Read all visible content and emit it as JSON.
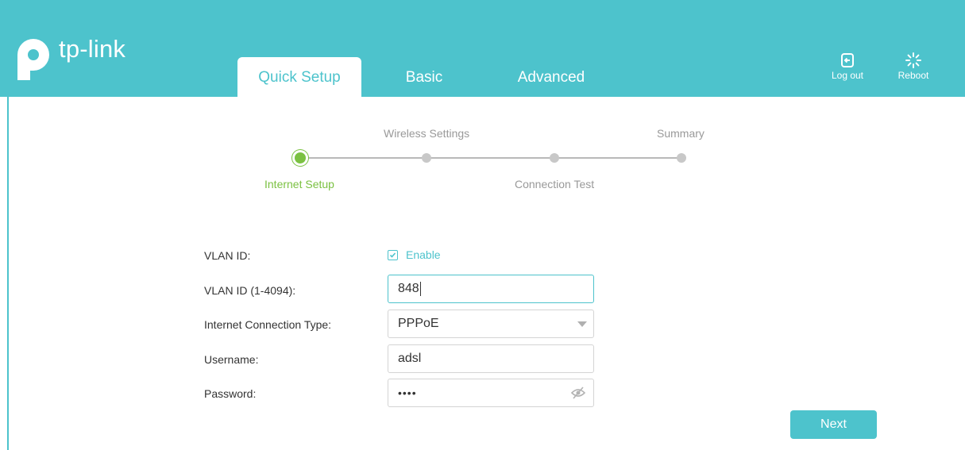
{
  "header": {
    "logo_text": "tp-link",
    "tabs": [
      {
        "label": "Quick Setup",
        "active": true
      },
      {
        "label": "Basic",
        "active": false
      },
      {
        "label": "Advanced",
        "active": false
      }
    ],
    "logout_label": "Log out",
    "reboot_label": "Reboot",
    "icons": {
      "logout": "logout-icon",
      "reboot": "reboot-icon"
    }
  },
  "stepper": {
    "steps": [
      {
        "label": "Internet Setup",
        "active": true
      },
      {
        "label": "Wireless Settings",
        "active": false
      },
      {
        "label": "Connection Test",
        "active": false
      },
      {
        "label": "Summary",
        "active": false
      }
    ]
  },
  "form": {
    "vlan_id_label": "VLAN ID:",
    "vlan_enable_label": "Enable",
    "vlan_enabled": true,
    "vlan_id_range_label": "VLAN ID (1-4094):",
    "vlan_id_value": "848",
    "connection_type_label": "Internet Connection Type:",
    "connection_type_value": "PPPoE",
    "username_label": "Username:",
    "username_value": "adsl",
    "password_label": "Password:",
    "password_value": "••••"
  },
  "actions": {
    "next_label": "Next"
  },
  "colors": {
    "accent": "#4dc3cc",
    "active_step": "#7bc142",
    "inactive": "#999999"
  }
}
